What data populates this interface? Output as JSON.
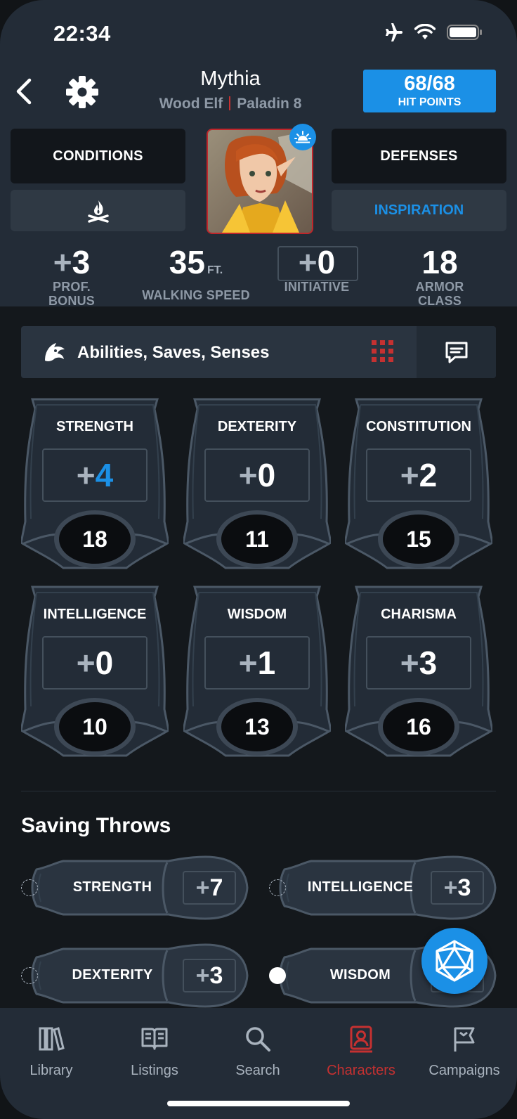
{
  "status": {
    "time": "22:34"
  },
  "header": {
    "name": "Mythia",
    "race": "Wood Elf",
    "class": "Paladin 8",
    "hp_value": "68/68",
    "hp_label": "HIT POINTS"
  },
  "buttons": {
    "conditions": "CONDITIONS",
    "defenses": "DEFENSES",
    "inspiration": "INSPIRATION"
  },
  "stats": {
    "prof_bonus": {
      "sign": "+",
      "value": "3",
      "label": "PROF. BONUS"
    },
    "walking_speed": {
      "value": "35",
      "unit": "FT.",
      "label": "WALKING SPEED"
    },
    "initiative": {
      "sign": "+",
      "value": "0",
      "label": "INITIATIVE"
    },
    "armor_class": {
      "value": "18",
      "label": "ARMOR CLASS"
    }
  },
  "section": {
    "title": "Abilities, Saves, Senses"
  },
  "abilities": [
    {
      "name": "STRENGTH",
      "sign": "+",
      "mod": "4",
      "score": "18"
    },
    {
      "name": "DEXTERITY",
      "sign": "+",
      "mod": "0",
      "score": "11"
    },
    {
      "name": "CONSTITUTION",
      "sign": "+",
      "mod": "2",
      "score": "15"
    },
    {
      "name": "INTELLIGENCE",
      "sign": "+",
      "mod": "0",
      "score": "10"
    },
    {
      "name": "WISDOM",
      "sign": "+",
      "mod": "1",
      "score": "13"
    },
    {
      "name": "CHARISMA",
      "sign": "+",
      "mod": "3",
      "score": "16"
    }
  ],
  "saving_throws": {
    "title": "Saving Throws",
    "items": [
      {
        "name": "STRENGTH",
        "sign": "+",
        "value": "7",
        "proficient": false
      },
      {
        "name": "INTELLIGENCE",
        "sign": "+",
        "value": "3",
        "proficient": false
      },
      {
        "name": "DEXTERITY",
        "sign": "+",
        "value": "3",
        "proficient": false
      },
      {
        "name": "WISDOM",
        "sign": "+",
        "value": "",
        "proficient": true
      }
    ]
  },
  "nav": {
    "items": [
      {
        "label": "Library",
        "icon": "library-icon"
      },
      {
        "label": "Listings",
        "icon": "book-icon"
      },
      {
        "label": "Search",
        "icon": "search-icon"
      },
      {
        "label": "Characters",
        "icon": "characters-icon",
        "active": true
      },
      {
        "label": "Campaigns",
        "icon": "flag-icon"
      }
    ]
  },
  "colors": {
    "accent": "#1b90e6",
    "active": "#c53131",
    "panel": "#232c37",
    "background": "#14181c"
  }
}
